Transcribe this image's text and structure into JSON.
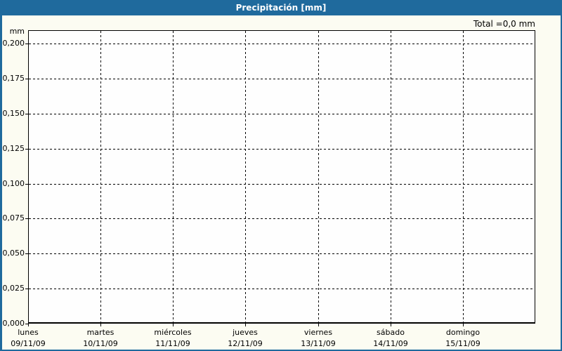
{
  "window": {
    "title": "Precipitación [mm]"
  },
  "summary": {
    "total_label": "Total =0,0 mm"
  },
  "chart_data": {
    "type": "bar",
    "title": "Precipitación [mm]",
    "total_annotation": "Total =0,0 mm",
    "grid": "dashed",
    "legend": "none",
    "y_axis": {
      "unit_label": "mm",
      "min": 0,
      "max": 0.2,
      "tick_step": 0.025,
      "ticks": [
        {
          "value": 0.2,
          "label": "0,200"
        },
        {
          "value": 0.175,
          "label": "0,175"
        },
        {
          "value": 0.15,
          "label": "0,150"
        },
        {
          "value": 0.125,
          "label": "0,125"
        },
        {
          "value": 0.1,
          "label": "0,100"
        },
        {
          "value": 0.075,
          "label": "0,075"
        },
        {
          "value": 0.05,
          "label": "0,050"
        },
        {
          "value": 0.025,
          "label": "0,025"
        },
        {
          "value": 0.0,
          "label": "0,000"
        }
      ]
    },
    "x_axis": {
      "categories": [
        {
          "day": "lunes",
          "date": "09/11/09"
        },
        {
          "day": "martes",
          "date": "10/11/09"
        },
        {
          "day": "miércoles",
          "date": "11/11/09"
        },
        {
          "day": "jueves",
          "date": "12/11/09"
        },
        {
          "day": "viernes",
          "date": "13/11/09"
        },
        {
          "day": "sábado",
          "date": "14/11/09"
        },
        {
          "day": "domingo",
          "date": "15/11/09"
        }
      ]
    },
    "series": [
      {
        "name": "Precipitación",
        "values": [
          0,
          0,
          0,
          0,
          0,
          0,
          0
        ]
      }
    ],
    "colors": {
      "header": "#1f6a9d",
      "header_text": "#ffffff",
      "background": "#fcfcf2",
      "plot_background": "#fefefe",
      "grid": "#000000",
      "text": "#000000",
      "bar": "#1f6a9d"
    }
  }
}
